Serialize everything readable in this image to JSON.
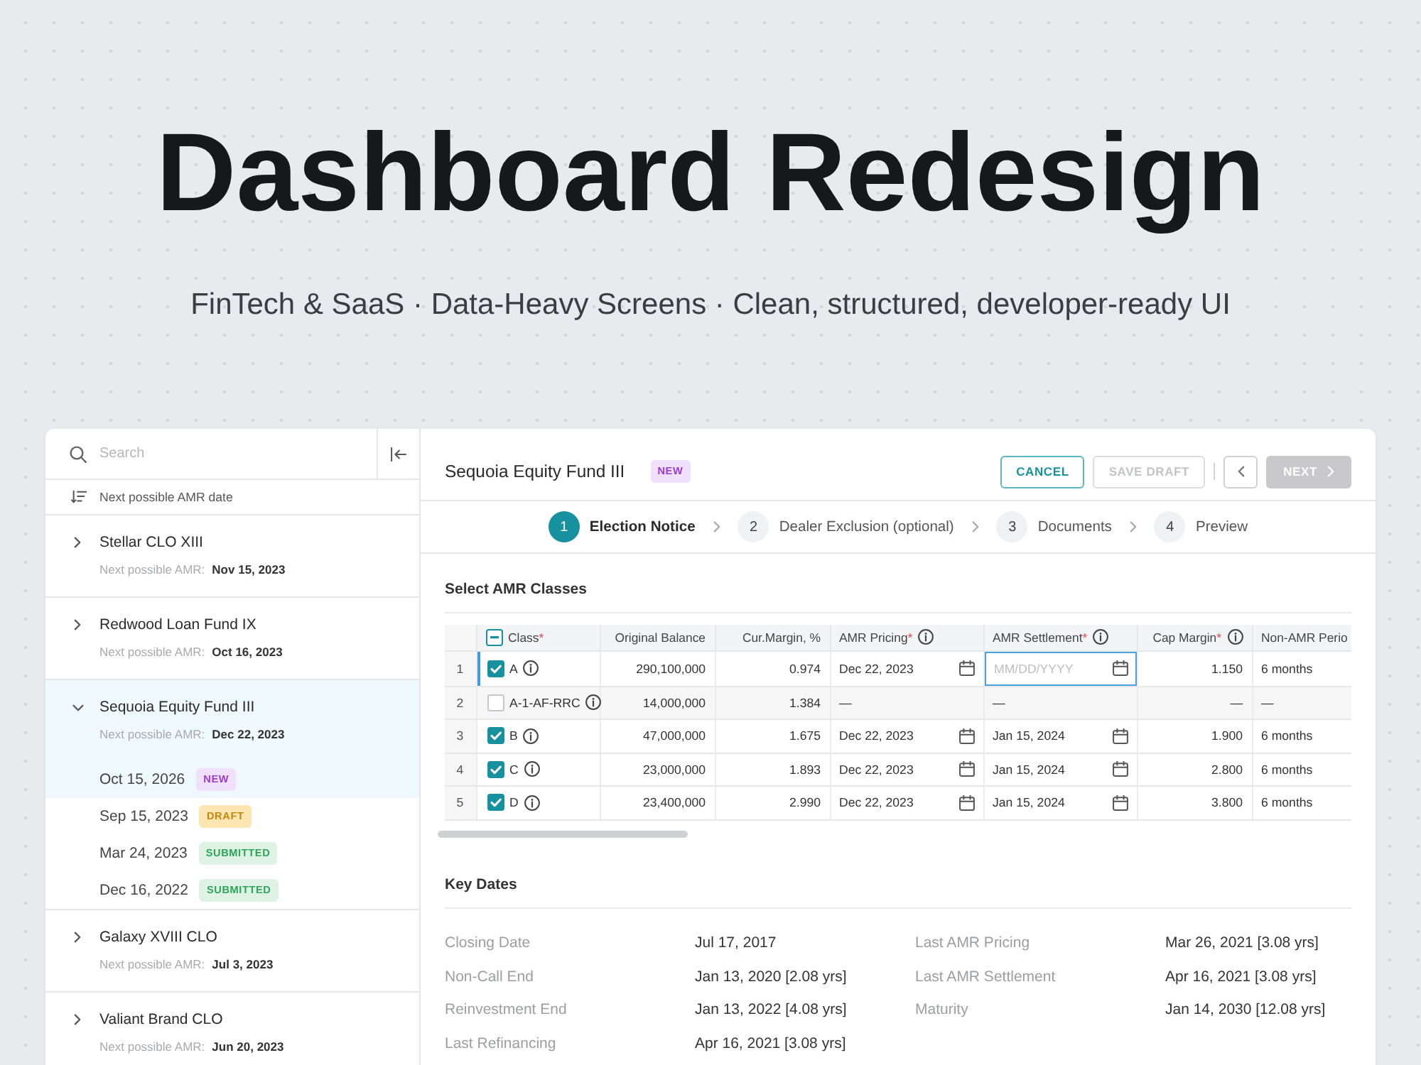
{
  "hero": {
    "title": "Dashboard Redesign",
    "subtitle": "FinTech & SaaS · Data-Heavy Screens · Clean, structured, developer-ready UI"
  },
  "sidebar": {
    "search": {
      "placeholder": "Search"
    },
    "sort": {
      "label": "Next possible AMR date"
    },
    "funds": [
      {
        "name": "Stellar CLO XIII",
        "amr_label": "Next possible AMR:",
        "amr_date": "Nov 15, 2023",
        "expanded": false,
        "selected": false
      },
      {
        "name": "Redwood Loan Fund IX",
        "amr_label": "Next possible AMR:",
        "amr_date": "Oct 16, 2023",
        "expanded": false,
        "selected": false
      },
      {
        "name": "Sequoia Equity Fund III",
        "amr_label": "Next possible AMR:",
        "amr_date": "Dec 22, 2023",
        "expanded": true,
        "selected": true,
        "notices": [
          {
            "date": "Oct 15, 2026",
            "status": "NEW",
            "kind": "new",
            "selected": true
          },
          {
            "date": "Sep 15, 2023",
            "status": "DRAFT",
            "kind": "draft",
            "selected": false
          },
          {
            "date": "Mar 24, 2023",
            "status": "SUBMITTED",
            "kind": "submitted",
            "selected": false
          },
          {
            "date": "Dec 16, 2022",
            "status": "SUBMITTED",
            "kind": "submitted",
            "selected": false
          }
        ]
      },
      {
        "name": "Galaxy XVIII CLO",
        "amr_label": "Next possible AMR:",
        "amr_date": "Jul 3, 2023",
        "expanded": false,
        "selected": false
      },
      {
        "name": "Valiant Brand CLO",
        "amr_label": "Next possible AMR:",
        "amr_date": "Jun 20, 2023",
        "expanded": false,
        "selected": false
      }
    ]
  },
  "main": {
    "title": "Sequoia Equity Fund III",
    "badge": {
      "label": "NEW",
      "kind": "new"
    },
    "buttons": [
      {
        "kind": "cancel",
        "label": "CANCEL",
        "disabled": false
      },
      {
        "kind": "save",
        "label": "SAVE DRAFT",
        "disabled": true
      },
      {
        "kind": "back",
        "disabled": false
      },
      {
        "kind": "next",
        "label": "NEXT",
        "disabled": true
      }
    ],
    "steps": [
      {
        "number": "1",
        "label": "Election Notice",
        "selected": true
      },
      {
        "number": "2",
        "label": "Dealer Exclusion (optional)",
        "selected": false
      },
      {
        "number": "3",
        "label": "Documents",
        "selected": false
      },
      {
        "number": "4",
        "label": "Preview",
        "selected": false
      }
    ],
    "classes": {
      "title": "Select AMR Classes",
      "select_all": {
        "indeterminate": true
      },
      "columns": [
        {
          "label": "Class",
          "kind": "class",
          "required_mark": "*",
          "info": false
        },
        {
          "label": "Original Balance",
          "kind": "number",
          "info": false
        },
        {
          "label": "Cur.Margin, %",
          "kind": "number",
          "info": false
        },
        {
          "label": "AMR Pricing",
          "kind": "date",
          "required_mark": "*",
          "info": true
        },
        {
          "label": "AMR Settlement",
          "kind": "date",
          "required_mark": "*",
          "info": true
        },
        {
          "label": "Cap Margin",
          "kind": "number",
          "required_mark": "*",
          "info": true
        },
        {
          "label": "Non-AMR Perio",
          "kind": "text",
          "info": false
        }
      ],
      "rows": [
        {
          "number": "1",
          "selected": true,
          "checked": true,
          "cells": [
            {
              "text": "A"
            },
            {
              "text": "290,100,000"
            },
            {
              "text": "0.974"
            },
            {
              "kind": "date",
              "text": "Dec 22, 2023"
            },
            {
              "kind": "date_input",
              "placeholder": "MM/DD/YYYY",
              "focused": true
            },
            {
              "text": "1.150"
            },
            {
              "text": "6 months"
            }
          ]
        },
        {
          "number": "2",
          "selected": false,
          "checked": false,
          "cells": [
            {
              "text": "A-1-AF-RRC"
            },
            {
              "text": "14,000,000"
            },
            {
              "text": "1.384"
            },
            {
              "text": "—"
            },
            {
              "text": "—"
            },
            {
              "text": "—"
            },
            {
              "text": "—"
            }
          ]
        },
        {
          "number": "3",
          "selected": false,
          "checked": true,
          "cells": [
            {
              "text": "B"
            },
            {
              "text": "47,000,000"
            },
            {
              "text": "1.675"
            },
            {
              "kind": "date",
              "text": "Dec 22, 2023"
            },
            {
              "kind": "date",
              "text": "Jan 15, 2024"
            },
            {
              "text": "1.900"
            },
            {
              "text": "6 months"
            }
          ]
        },
        {
          "number": "4",
          "selected": false,
          "checked": true,
          "cells": [
            {
              "text": "C"
            },
            {
              "text": "23,000,000"
            },
            {
              "text": "1.893"
            },
            {
              "kind": "date",
              "text": "Dec 22, 2023"
            },
            {
              "kind": "date",
              "text": "Jan 15, 2024"
            },
            {
              "text": "2.800"
            },
            {
              "text": "6 months"
            }
          ]
        },
        {
          "number": "5",
          "selected": false,
          "checked": true,
          "cells": [
            {
              "text": "D"
            },
            {
              "text": "23,400,000"
            },
            {
              "text": "2.990"
            },
            {
              "kind": "date",
              "text": "Dec 22, 2023"
            },
            {
              "kind": "date",
              "text": "Jan 15, 2024"
            },
            {
              "text": "3.800"
            },
            {
              "text": "6 months"
            }
          ]
        }
      ]
    },
    "key_dates": {
      "title": "Key Dates",
      "items": [
        {
          "label": "Closing Date",
          "value": "Jul 17, 2017"
        },
        {
          "label": "Last AMR Pricing",
          "value": "Mar 26, 2021 [3.08 yrs]"
        },
        {
          "label": "Non-Call End",
          "value": "Jan 13, 2020 [2.08 yrs]"
        },
        {
          "label": "Last AMR Settlement",
          "value": "Apr 16, 2021 [3.08 yrs]"
        },
        {
          "label": "Reinvestment End",
          "value": "Jan 13, 2022 [4.08 yrs]"
        },
        {
          "label": "Maturity",
          "value": "Jan 14, 2030 [12.08 yrs]"
        },
        {
          "label": "Last Refinancing",
          "value": "Apr 16, 2021 [3.08 yrs]"
        }
      ]
    }
  }
}
